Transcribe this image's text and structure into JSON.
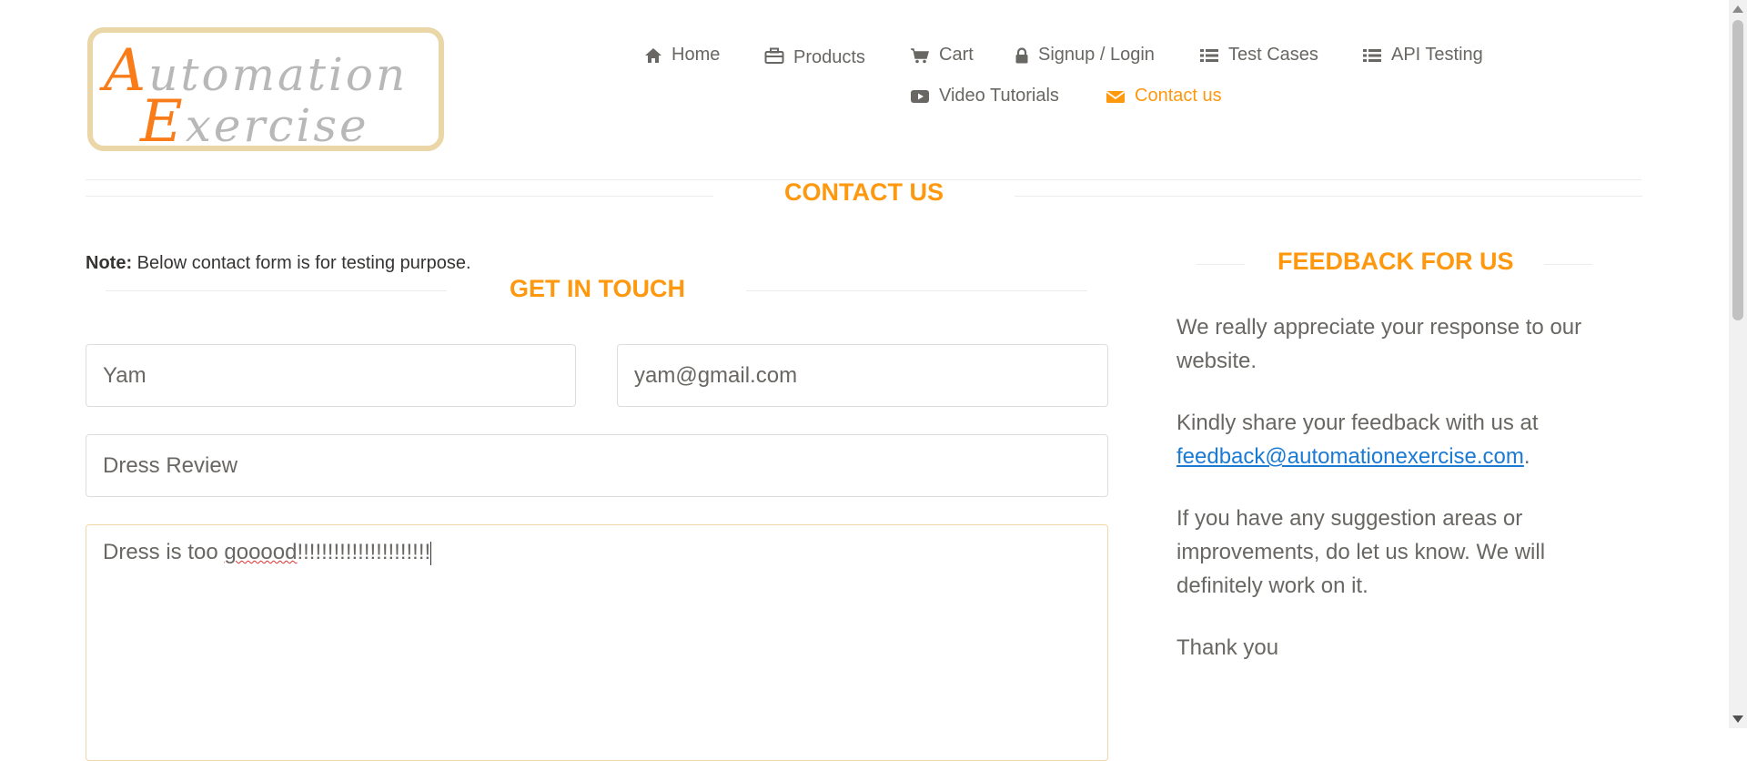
{
  "logo": {
    "line1_cap": "A",
    "line1_rest": "utomation",
    "line2_cap": "E",
    "line2_rest": "xercise"
  },
  "nav": [
    {
      "label": "Home",
      "icon": "home-icon"
    },
    {
      "label": "Products",
      "icon": "briefcase-icon"
    },
    {
      "label": "Cart",
      "icon": "cart-icon"
    },
    {
      "label": "Signup / Login",
      "icon": "lock-icon"
    },
    {
      "label": "Test Cases",
      "icon": "list-icon"
    },
    {
      "label": "API Testing",
      "icon": "list-icon"
    },
    {
      "label": "Video Tutorials",
      "icon": "youtube-play-icon"
    },
    {
      "label": "Contact us",
      "icon": "envelope-icon",
      "active": true
    }
  ],
  "page_title": "CONTACT US",
  "note": {
    "bold": "Note:",
    "text": " Below contact form is for testing purpose."
  },
  "get_in_touch": "GET IN TOUCH",
  "form": {
    "name_value": "Yam",
    "email_value": "yam@gmail.com",
    "subject_value": "Dress Review",
    "message_before": "Dress is too ",
    "message_misspelled": "gooood",
    "message_after": "!!!!!!!!!!!!!!!!!!!!!!"
  },
  "feedback": {
    "title": "FEEDBACK FOR US",
    "p1": "We really appreciate your response to our website.",
    "p2_text": "Kindly share your feedback with us at ",
    "p2_link": "feedback@automationexercise.com",
    "p2_end": ".",
    "p3": "If you have any suggestion areas or improvements, do let us know. We will definitely work on it.",
    "p4": "Thank you"
  },
  "colors": {
    "accent": "#fe980f",
    "text": "#696763",
    "link": "#1a7ad4",
    "border": "#dddddd"
  }
}
